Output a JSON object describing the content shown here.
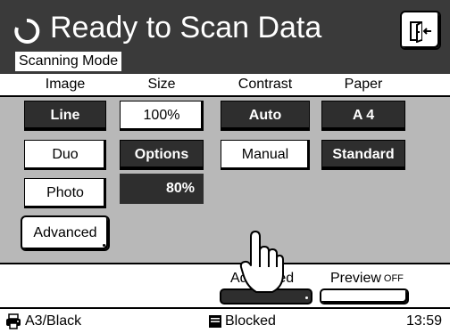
{
  "header": {
    "title": "Ready to Scan Data",
    "mode_label": "Scanning Mode",
    "bg_color": "#3a3a3a",
    "title_icon": "refresh-icon",
    "exit_icon": "exit-door-icon"
  },
  "columns": {
    "image": "Image",
    "size": "Size",
    "contrast": "Contrast",
    "paper": "Paper"
  },
  "image_options": {
    "line": "Line",
    "duo": "Duo",
    "photo": "Photo",
    "selected": "Line"
  },
  "size_options": {
    "percent_100": "100%",
    "options": "Options",
    "value_80": "80%",
    "selected": "Options"
  },
  "contrast_options": {
    "auto": "Auto",
    "manual": "Manual",
    "selected": "Auto"
  },
  "paper_options": {
    "a4": "A 4",
    "standard": "Standard",
    "selected": [
      "A 4",
      "Standard"
    ]
  },
  "advanced_left": "Advanced",
  "bottom": {
    "advanced_label": "Advanced",
    "preview_label": "Preview",
    "preview_state": "OFF"
  },
  "status": {
    "paper": "A3/Black",
    "paper_icon": "printer-icon",
    "blocked": "Blocked",
    "blocked_icon": "document-icon",
    "time": "13:59"
  },
  "colors": {
    "panel_bg": "#b8b8b8",
    "selected_btn": "#2e2e2e",
    "unselected_btn": "#ffffff"
  }
}
